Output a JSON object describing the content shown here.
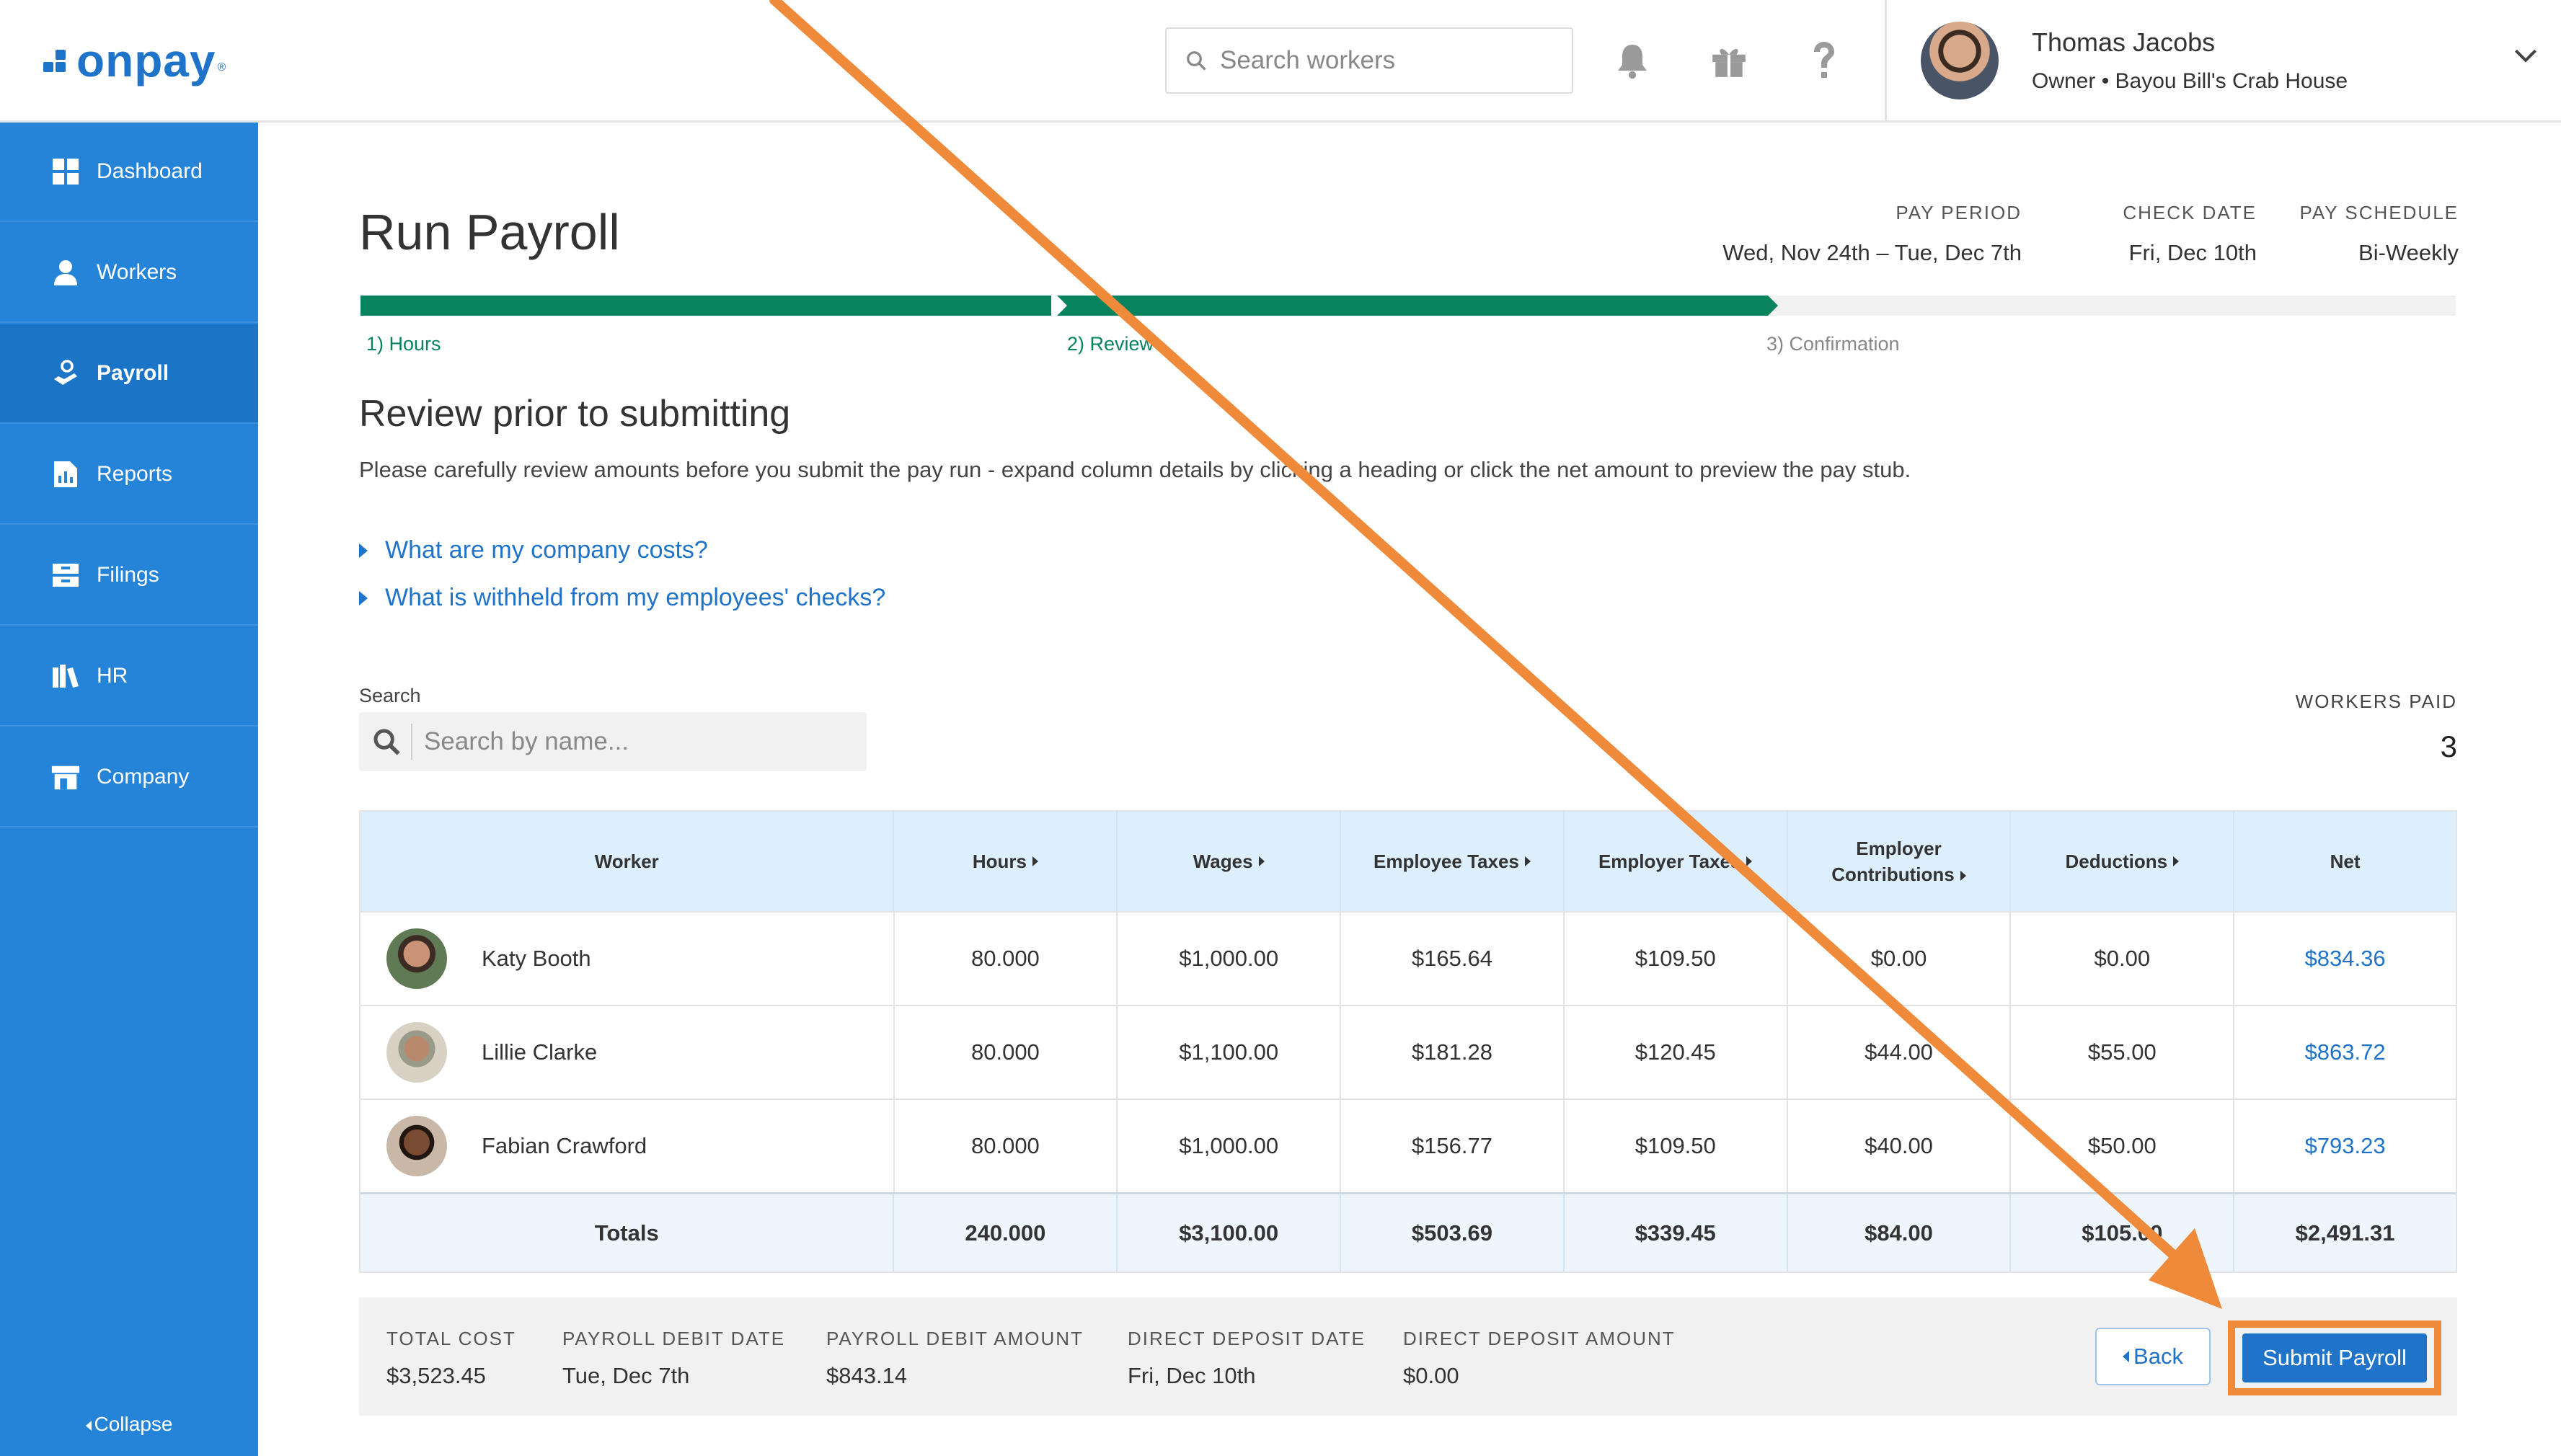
{
  "header": {
    "logo_text": "onpay",
    "logo_mark": "®",
    "search_placeholder": "Search workers",
    "user_name": "Thomas Jacobs",
    "user_role": "Owner • Bayou Bill's Crab House",
    "icons": [
      "bell-icon",
      "gift-icon",
      "help-icon",
      "chevron-down-icon"
    ]
  },
  "sidebar": {
    "items": [
      {
        "label": "Dashboard",
        "icon": "dashboard-icon"
      },
      {
        "label": "Workers",
        "icon": "workers-icon"
      },
      {
        "label": "Payroll",
        "icon": "payroll-icon",
        "active": true
      },
      {
        "label": "Reports",
        "icon": "reports-icon"
      },
      {
        "label": "Filings",
        "icon": "filings-icon"
      },
      {
        "label": "HR",
        "icon": "hr-icon"
      },
      {
        "label": "Company",
        "icon": "company-icon"
      }
    ],
    "collapse_label": "Collapse"
  },
  "page": {
    "title": "Run Payroll",
    "pay_period_label": "PAY PERIOD",
    "pay_period_value": "Wed, Nov 24th – Tue, Dec 7th",
    "check_date_label": "CHECK DATE",
    "check_date_value": "Fri, Dec 10th",
    "pay_schedule_label": "PAY SCHEDULE",
    "pay_schedule_value": "Bi-Weekly"
  },
  "steps": [
    {
      "label": "1) Hours",
      "state": "done"
    },
    {
      "label": "2) Review",
      "state": "current"
    },
    {
      "label": "3) Confirmation",
      "state": "pending"
    }
  ],
  "review": {
    "title": "Review prior to submitting",
    "description": "Please carefully review amounts before you submit the pay run - expand column details by clicking a heading or click the net amount to preview the pay stub.",
    "faq": [
      "What are my company costs?",
      "What is withheld from my employees' checks?"
    ],
    "search_label": "Search",
    "search_placeholder": "Search by name...",
    "workers_paid_label": "WORKERS PAID",
    "workers_paid_value": "3"
  },
  "table": {
    "columns": {
      "worker": "Worker",
      "hours": "Hours",
      "wages": "Wages",
      "employee_taxes": "Employee Taxes",
      "employer_taxes": "Employer Taxes",
      "employer_contributions_1": "Employer",
      "employer_contributions_2": "Contributions",
      "deductions": "Deductions",
      "net": "Net"
    },
    "rows": [
      {
        "name": "Katy Booth",
        "hours": "80.000",
        "wages": "$1,000.00",
        "employee_taxes": "$165.64",
        "employer_taxes": "$109.50",
        "employer_contributions": "$0.00",
        "deductions": "$0.00",
        "net": "$834.36"
      },
      {
        "name": "Lillie Clarke",
        "hours": "80.000",
        "wages": "$1,100.00",
        "employee_taxes": "$181.28",
        "employer_taxes": "$120.45",
        "employer_contributions": "$44.00",
        "deductions": "$55.00",
        "net": "$863.72"
      },
      {
        "name": "Fabian Crawford",
        "hours": "80.000",
        "wages": "$1,000.00",
        "employee_taxes": "$156.77",
        "employer_taxes": "$109.50",
        "employer_contributions": "$40.00",
        "deductions": "$50.00",
        "net": "$793.23"
      }
    ],
    "totals": {
      "label": "Totals",
      "hours": "240.000",
      "wages": "$3,100.00",
      "employee_taxes": "$503.69",
      "employer_taxes": "$339.45",
      "employer_contributions": "$84.00",
      "deductions": "$105.00",
      "net": "$2,491.31"
    }
  },
  "summary": {
    "total_cost_label": "TOTAL COST",
    "total_cost_value": "$3,523.45",
    "debit_date_label": "PAYROLL DEBIT DATE",
    "debit_date_value": "Tue, Dec 7th",
    "debit_amount_label": "PAYROLL DEBIT AMOUNT",
    "debit_amount_value": "$843.14",
    "dd_date_label": "DIRECT DEPOSIT DATE",
    "dd_date_value": "Fri, Dec 10th",
    "dd_amount_label": "DIRECT DEPOSIT AMOUNT",
    "dd_amount_value": "$0.00",
    "back_label": "Back",
    "submit_label": "Submit Payroll"
  },
  "colors": {
    "brand_blue": "#1f73c8",
    "sidebar_blue": "#2684d8",
    "progress_green": "#07845e",
    "annotation_orange": "#ee8a3a"
  }
}
